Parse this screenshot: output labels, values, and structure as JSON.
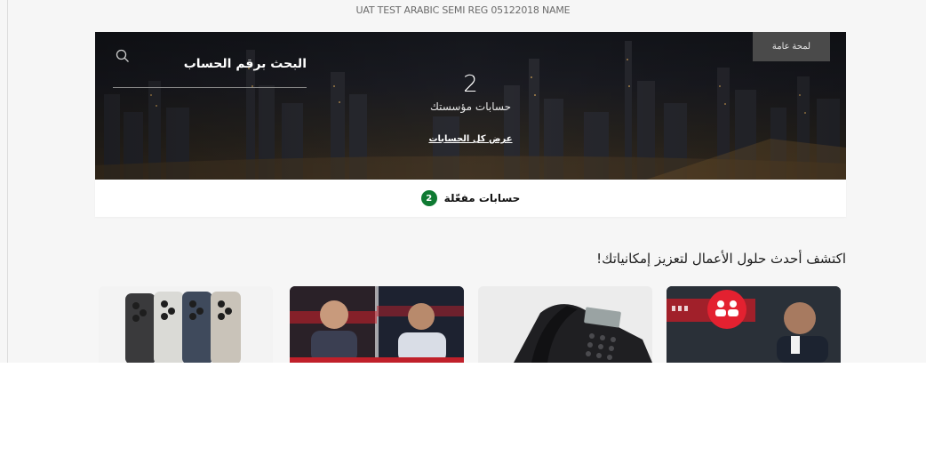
{
  "account_name": "UAT TEST ARABIC SEMI REG 05122018 NAME",
  "hero": {
    "overview_label": "لمحة عامة",
    "search_label": "البحث برقم الحساب",
    "accounts_count": "2",
    "accounts_label": "حسابات مؤسستك",
    "view_all_label": "عرض كل الحسابات"
  },
  "activated": {
    "count": "2",
    "label": "حسابات مفعّلة"
  },
  "discover": {
    "title": "اكتشف أحدث حلول الأعمال لتعزيز إمكانياتك!",
    "cards": [
      {
        "icon": "phones-icon"
      },
      {
        "icon": "video-call-icon"
      },
      {
        "icon": "desk-phone-icon"
      },
      {
        "icon": "users-icon"
      }
    ]
  },
  "colors": {
    "badge_green": "#0f7a32",
    "hero_dark": "#1c1d24",
    "accent_red": "#e11d2a"
  }
}
